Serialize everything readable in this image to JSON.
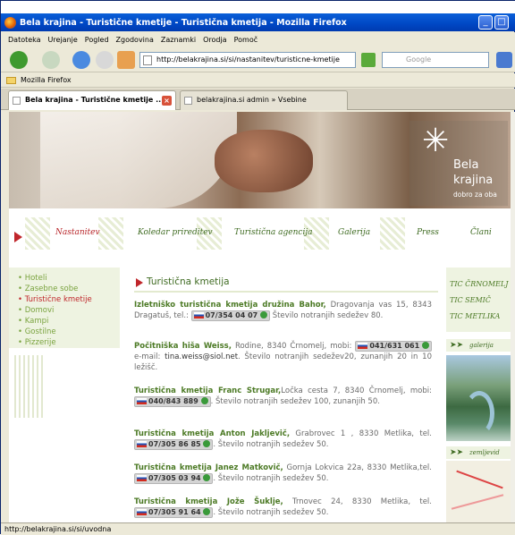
{
  "window": {
    "title": "Bela krajina - Turistične kmetije - Turistična kmetija - Mozilla Firefox"
  },
  "menu": {
    "items": [
      "Datoteka",
      "Urejanje",
      "Pogled",
      "Zgodovina",
      "Zaznamki",
      "Orodja",
      "Pomoč"
    ]
  },
  "address": {
    "url": "http://belakrajina.si/si/nastanitev/turisticne-kmetije"
  },
  "search": {
    "placeholder": "Google"
  },
  "bookmarks": {
    "items": [
      "Mozilla Firefox"
    ]
  },
  "tabs": [
    {
      "label": "Bela krajina - Turistične kmetije ..."
    },
    {
      "label": "belakrajina.si admin » Vsebine"
    }
  ],
  "banner": {
    "logo_line1": "Bela",
    "logo_line2": "krajina",
    "logo_tagline": "dobro za oba"
  },
  "nav": {
    "items": [
      "Nastanitev",
      "Koledar prireditev",
      "Turistična agencija",
      "Galerija",
      "Press",
      "Člani"
    ]
  },
  "sidebar": {
    "items": [
      "Hoteli",
      "Zasebne sobe",
      "Turistične kmetije",
      "Domovi",
      "Kampi",
      "Gostilne",
      "Pizzerije"
    ]
  },
  "main": {
    "title": "Turistična kmetija",
    "entries": [
      {
        "name": "Izletniško turistična kmetija družina Bahor,",
        "before": " Dragovanja vas 15, 8343 Dragatuš, tel.: ",
        "tel": "07/354 04 07",
        "after": " Število notranjih sedežev 80."
      },
      {
        "name": "Počitniška hiša Weiss,",
        "before": " Rodine, 8340 Črnomelj, mobi: ",
        "tel": "041/631 061",
        "mid": " e-mail: ",
        "mail": "tina.weiss@siol.net",
        "after": ". Število notranjih sedežev20, zunanjih 20 in 10 ležišč."
      },
      {
        "name": "Turistična kmetija Franc Strugar,",
        "before": "Ločka cesta 7, 8340 Črnomelj, mobi: ",
        "tel": "040/843 889",
        "after": ". Število notranjih sedežev 100, zunanjih 50."
      },
      {
        "name": "Turistična kmetija Anton Jakljevič,",
        "before": " Grabrovec 1 , 8330 Metlika, tel. ",
        "tel": "07/305 86 85",
        "after": ". Število notranjih sedežev 50."
      },
      {
        "name": "Turistična kmetija Janez Matkovič,",
        "before": " Gornja Lokvica 22a, 8330 Metlika,tel. ",
        "tel": "07/305 03 94",
        "after": ". Število notranjih sedežev 50."
      },
      {
        "name": "Turistična kmetija Jože Šuklje,",
        "before": " Trnovec 24, 8330 Metlika, tel. ",
        "tel": "07/305 91 64",
        "after": ". Število notranjih sedežev 50."
      }
    ]
  },
  "right": {
    "tic": [
      "TIC ČRNOMELJ",
      "TIC SEMIČ",
      "TIC METLIKA"
    ],
    "gallery_label": "galerija",
    "map_label": "zemljevid"
  },
  "status": {
    "text": "http://belakrajina.si/si/uvodna"
  }
}
